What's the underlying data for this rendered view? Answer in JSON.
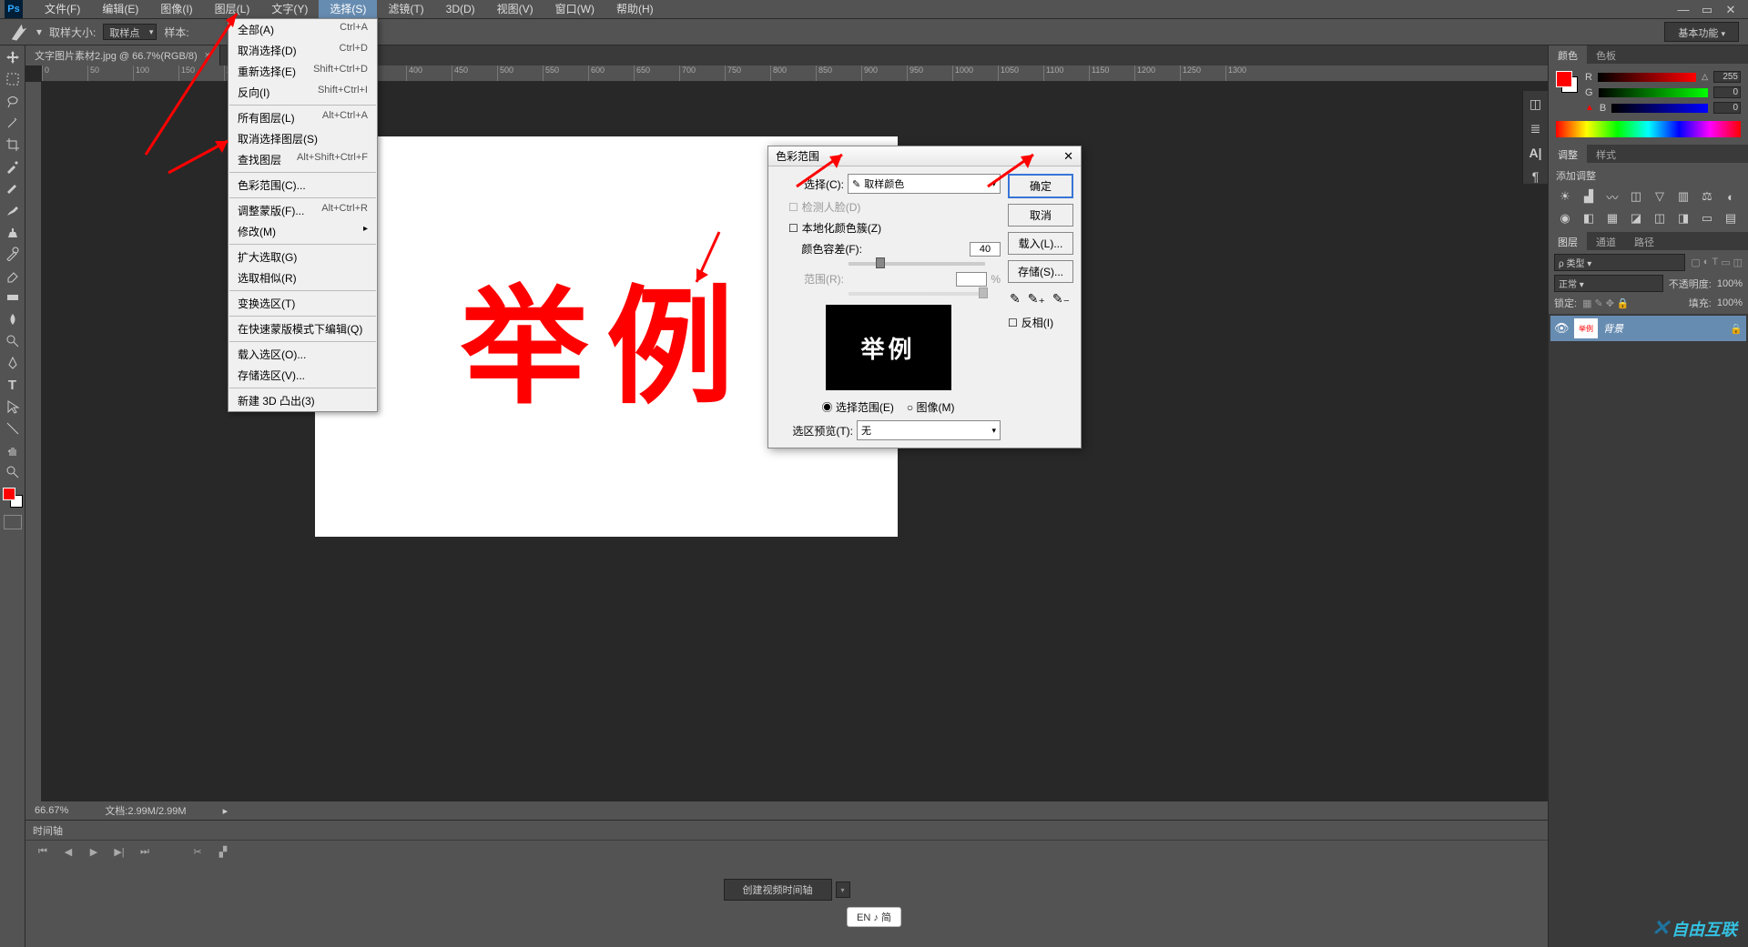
{
  "app": {
    "logo": "Ps"
  },
  "menus": [
    "文件(F)",
    "编辑(E)",
    "图像(I)",
    "图层(L)",
    "文字(Y)",
    "选择(S)",
    "滤镜(T)",
    "3D(D)",
    "视图(V)",
    "窗口(W)",
    "帮助(H)"
  ],
  "active_menu_index": 5,
  "options_bar": {
    "sample_size_label": "取样大小:",
    "sample_size_value": "取样点",
    "sample_label": "样本:"
  },
  "workspace_switcher": "基本功能",
  "document_tab": {
    "title": "文字图片素材2.jpg @ 66.7%(RGB/8)"
  },
  "canvas_text": "举例",
  "status": {
    "zoom": "66.67%",
    "doc_info": "文档:2.99M/2.99M"
  },
  "timeline": {
    "tab": "时间轴",
    "create_button": "创建视频时间轴"
  },
  "dropdown": {
    "groups": [
      [
        {
          "label": "全部(A)",
          "shortcut": "Ctrl+A"
        },
        {
          "label": "取消选择(D)",
          "shortcut": "Ctrl+D"
        },
        {
          "label": "重新选择(E)",
          "shortcut": "Shift+Ctrl+D"
        },
        {
          "label": "反向(I)",
          "shortcut": "Shift+Ctrl+I"
        }
      ],
      [
        {
          "label": "所有图层(L)",
          "shortcut": "Alt+Ctrl+A"
        },
        {
          "label": "取消选择图层(S)",
          "shortcut": ""
        },
        {
          "label": "查找图层",
          "shortcut": "Alt+Shift+Ctrl+F"
        }
      ],
      [
        {
          "label": "色彩范围(C)...",
          "shortcut": ""
        }
      ],
      [
        {
          "label": "调整蒙版(F)...",
          "shortcut": "Alt+Ctrl+R"
        },
        {
          "label": "修改(M)",
          "shortcut": "",
          "submenu": true
        }
      ],
      [
        {
          "label": "扩大选取(G)",
          "shortcut": ""
        },
        {
          "label": "选取相似(R)",
          "shortcut": ""
        }
      ],
      [
        {
          "label": "变换选区(T)",
          "shortcut": ""
        }
      ],
      [
        {
          "label": "在快速蒙版模式下编辑(Q)",
          "shortcut": ""
        }
      ],
      [
        {
          "label": "载入选区(O)...",
          "shortcut": ""
        },
        {
          "label": "存储选区(V)...",
          "shortcut": ""
        }
      ],
      [
        {
          "label": "新建 3D 凸出(3)",
          "shortcut": ""
        }
      ]
    ]
  },
  "dialog": {
    "title": "色彩范围",
    "select_label": "选择(C):",
    "select_value": "取样颜色",
    "detect_faces": "检测人脸(D)",
    "localized": "本地化颜色簇(Z)",
    "fuzziness_label": "颜色容差(F):",
    "fuzziness_value": "40",
    "range_label": "范围(R):",
    "range_unit": "%",
    "preview_text": "举例",
    "radio_selection": "选择范围(E)",
    "radio_image": "图像(M)",
    "selection_preview_label": "选区预览(T):",
    "selection_preview_value": "无",
    "buttons": {
      "ok": "确定",
      "cancel": "取消",
      "load": "载入(L)...",
      "save": "存储(S)..."
    },
    "invert": "反相(I)"
  },
  "panels": {
    "color_tab": "颜色",
    "swatches_tab": "色板",
    "r": "R",
    "g": "G",
    "b": "B",
    "r_val": "255",
    "g_val": "0",
    "b_val": "0",
    "adjustments_tab": "调整",
    "styles_tab": "样式",
    "add_adjustment": "添加调整",
    "layers_tab": "图层",
    "channels_tab": "通道",
    "paths_tab": "路径",
    "kind_label": "ρ 类型",
    "blend_mode": "正常",
    "opacity_label": "不透明度:",
    "opacity_value": "100%",
    "lock_label": "锁定:",
    "fill_label": "填充:",
    "fill_value": "100%",
    "layer_name": "背景",
    "layer_thumb_text": "举例"
  },
  "lang_indicator": "EN ♪ 简",
  "watermark": "自由互联"
}
